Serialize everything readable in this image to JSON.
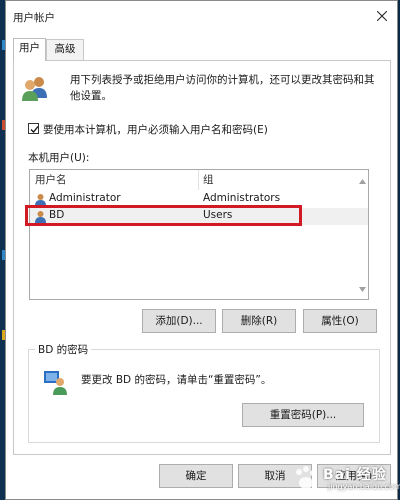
{
  "window": {
    "title": "用户帐户"
  },
  "tabs": [
    {
      "label": "用户"
    },
    {
      "label": "高级"
    }
  ],
  "info_text": "用下列表授予或拒绝用户访问你的计算机，还可以更改其密码和其他设置。",
  "require_login": {
    "checked": true,
    "label": "要使用本计算机，用户必须输入用户名和密码(E)"
  },
  "user_list": {
    "label": "本机用户(U):",
    "columns": [
      "用户名",
      "组"
    ],
    "rows": [
      {
        "name": "Administrator",
        "group": "Administrators"
      },
      {
        "name": "BD",
        "group": "Users"
      }
    ],
    "highlighted_row": 1
  },
  "list_buttons": {
    "add": "添加(D)...",
    "remove": "删除(R)",
    "properties": "属性(O)"
  },
  "password_group": {
    "title": "BD 的密码",
    "text": "要更改 BD 的密码，请单击“重置密码”。",
    "reset_button": "重置密码(P)..."
  },
  "footer": {
    "ok": "确定",
    "cancel": "取消",
    "apply": "应用(A)"
  },
  "watermark": {
    "text": "Bai 经验",
    "url": "jingyan.baidu.com"
  },
  "colors": {
    "highlight_box": "#d11a24",
    "button_face": "#e1e1e1",
    "desktop": "#0b2a48"
  }
}
